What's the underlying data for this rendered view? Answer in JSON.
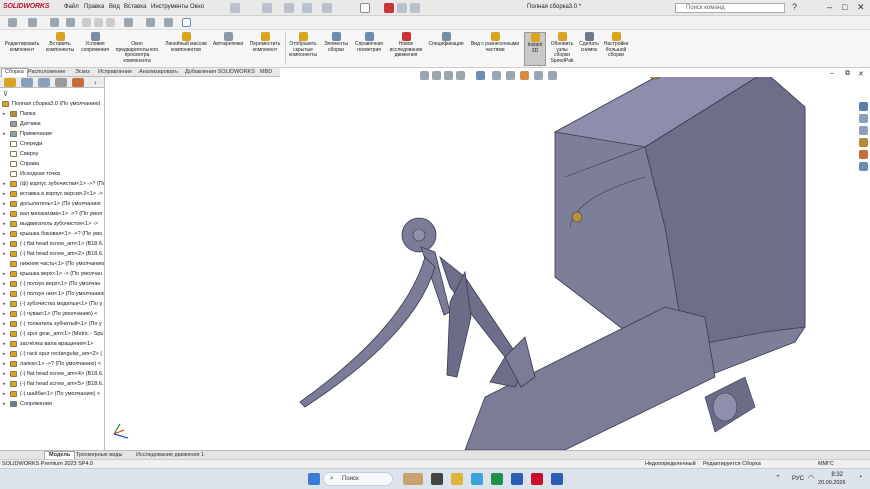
{
  "app": {
    "logo": "SOLIDWORKS",
    "doc_title": "Полная сборка3.0 *"
  },
  "menu": [
    "Файл",
    "Правка",
    "Вид",
    "Вставка",
    "Инструменты",
    "Окно"
  ],
  "search": {
    "placeholder": "Поиск команд"
  },
  "commands": [
    {
      "label": "Редактировать компонент",
      "disabled": true
    },
    {
      "label": "Вставить компоненты",
      "disabled": false
    },
    {
      "label": "Условия сопряжения",
      "disabled": false
    },
    {
      "label": "Окно предварительного просмотра компонента",
      "disabled": true
    },
    {
      "label": "Линейный массив компонентов",
      "disabled": false
    },
    {
      "label": "Автокрепежи",
      "disabled": false
    },
    {
      "label": "Переместить компонент",
      "disabled": false
    },
    {
      "label": "Отобразить скрытые компоненты",
      "disabled": false
    },
    {
      "label": "Элементы сборки",
      "disabled": false
    },
    {
      "label": "Справочная геометрия",
      "disabled": false
    },
    {
      "label": "Новое исследование движения",
      "disabled": false
    },
    {
      "label": "Спецификация",
      "disabled": false
    },
    {
      "label": "Вид с разнесенными частями",
      "disabled": false
    },
    {
      "label": "Instant 3D",
      "disabled": false,
      "active": true
    },
    {
      "label": "Обновить узлы сборки SpeedPak",
      "disabled": false
    },
    {
      "label": "Сделать снимок",
      "disabled": false
    },
    {
      "label": "Настройки большой сборки",
      "disabled": false
    }
  ],
  "tabs": [
    "Сборка",
    "Расположение",
    "Эскиз",
    "Исправление",
    "Анализировать",
    "Добавления SOLIDWORKS",
    "MBD"
  ],
  "tree": [
    {
      "label": "Полная сборка3.0 (По умолчанию)",
      "indent": 0,
      "expander": "",
      "icon": "#d9a520"
    },
    {
      "label": "Папка",
      "indent": 1,
      "expander": "▸",
      "icon": "#b48a3c"
    },
    {
      "label": "Датчики",
      "indent": 1,
      "expander": "",
      "icon": "#8aa0b8"
    },
    {
      "label": "Примечания",
      "indent": 1,
      "expander": "▸",
      "icon": "#8aa0b8"
    },
    {
      "label": "Спереди",
      "indent": 1,
      "expander": "",
      "icon": "#ffffff"
    },
    {
      "label": "Сверху",
      "indent": 1,
      "expander": "",
      "icon": "#ffffff"
    },
    {
      "label": "Справа",
      "indent": 1,
      "expander": "",
      "icon": "#ffffff"
    },
    {
      "label": "Исходная точка",
      "indent": 1,
      "expander": "",
      "icon": "#ffffff"
    },
    {
      "label": "(ф) корпус зубочистки<1> ->? (По",
      "indent": 1,
      "expander": "▸",
      "icon": "#d9a520"
    },
    {
      "label": "вставка в корпус версия.2<1> ->",
      "indent": 1,
      "expander": "▸",
      "icon": "#d9a520"
    },
    {
      "label": "досылатель<1> (По умолчанию",
      "indent": 1,
      "expander": "▸",
      "icon": "#d9a520"
    },
    {
      "label": "вал механизма<1> ->? (По умол",
      "indent": 1,
      "expander": "▸",
      "icon": "#d9a520"
    },
    {
      "label": "выдвигатель зубочисток<1> ->",
      "indent": 1,
      "expander": "▸",
      "icon": "#d9a520"
    },
    {
      "label": "крышка боковая<1> ->? (По умо",
      "indent": 1,
      "expander": "▸",
      "icon": "#d9a520"
    },
    {
      "label": "(-) flat head screw_am<1> (B18.6.",
      "indent": 1,
      "expander": "▸",
      "icon": "#d9a520"
    },
    {
      "label": "(-) flat head screw_am<2> (B18.6.",
      "indent": 1,
      "expander": "▸",
      "icon": "#d9a520"
    },
    {
      "label": "нижняя часть<1> (По умолчанию",
      "indent": 1,
      "expander": "",
      "icon": "#d9a520"
    },
    {
      "label": "крышка верх<1> -> (По умолчан",
      "indent": 1,
      "expander": "▸",
      "icon": "#d9a520"
    },
    {
      "label": "(-) ползун верх<1> (По умолчан",
      "indent": 1,
      "expander": "▸",
      "icon": "#d9a520"
    },
    {
      "label": "(-) ползун низ<1> (По умолчанию",
      "indent": 1,
      "expander": "▸",
      "icon": "#d9a520"
    },
    {
      "label": "(-) зубочистка модельк<1> (По у",
      "indent": 1,
      "expander": "▸",
      "icon": "#d9a520"
    },
    {
      "label": "(-) чувак<1> (По умолчанию) <",
      "indent": 1,
      "expander": "▸",
      "icon": "#d9a520"
    },
    {
      "label": "(-) толкатель зубчатый<1> (По у",
      "indent": 1,
      "expander": "▸",
      "icon": "#d9a520"
    },
    {
      "label": "(-) spur gear_am<1> (Metric - Spu",
      "indent": 1,
      "expander": "▸",
      "icon": "#d9a520"
    },
    {
      "label": "засчёлка вала вращения<1>",
      "indent": 1,
      "expander": "▸",
      "icon": "#d9a520"
    },
    {
      "label": "(-) rack spur rectangular_am<2> (",
      "indent": 1,
      "expander": "▸",
      "icon": "#d9a520"
    },
    {
      "label": "лапка<1> ->? (По умолчанию) <",
      "indent": 1,
      "expander": "▸",
      "icon": "#d9a520"
    },
    {
      "label": "(-) flat head screw_am<4> (B18.6.",
      "indent": 1,
      "expander": "▸",
      "icon": "#d9a520"
    },
    {
      "label": "(-) flat head screw_am<5> (B18.6.",
      "indent": 1,
      "expander": "▸",
      "icon": "#d9a520"
    },
    {
      "label": "(-) шайба<1> (По умолчанию) <",
      "indent": 1,
      "expander": "▸",
      "icon": "#d9a520"
    },
    {
      "label": "Сопряжения",
      "indent": 1,
      "expander": "▸",
      "icon": "#5a7fa8"
    }
  ],
  "bottom_tabs": [
    "Модель",
    "Трехмерные виды",
    "Исследование движения 1"
  ],
  "status": {
    "left": "SOLIDWORKS Premium 2023 SP4.0",
    "state": "Недоопределенный",
    "editing": "Редактируется Сборка",
    "units": "ММГС"
  },
  "taskbar": {
    "search_label": "Поиск",
    "lang": "РУС",
    "time": "8:32",
    "date": "20.09.2026"
  }
}
